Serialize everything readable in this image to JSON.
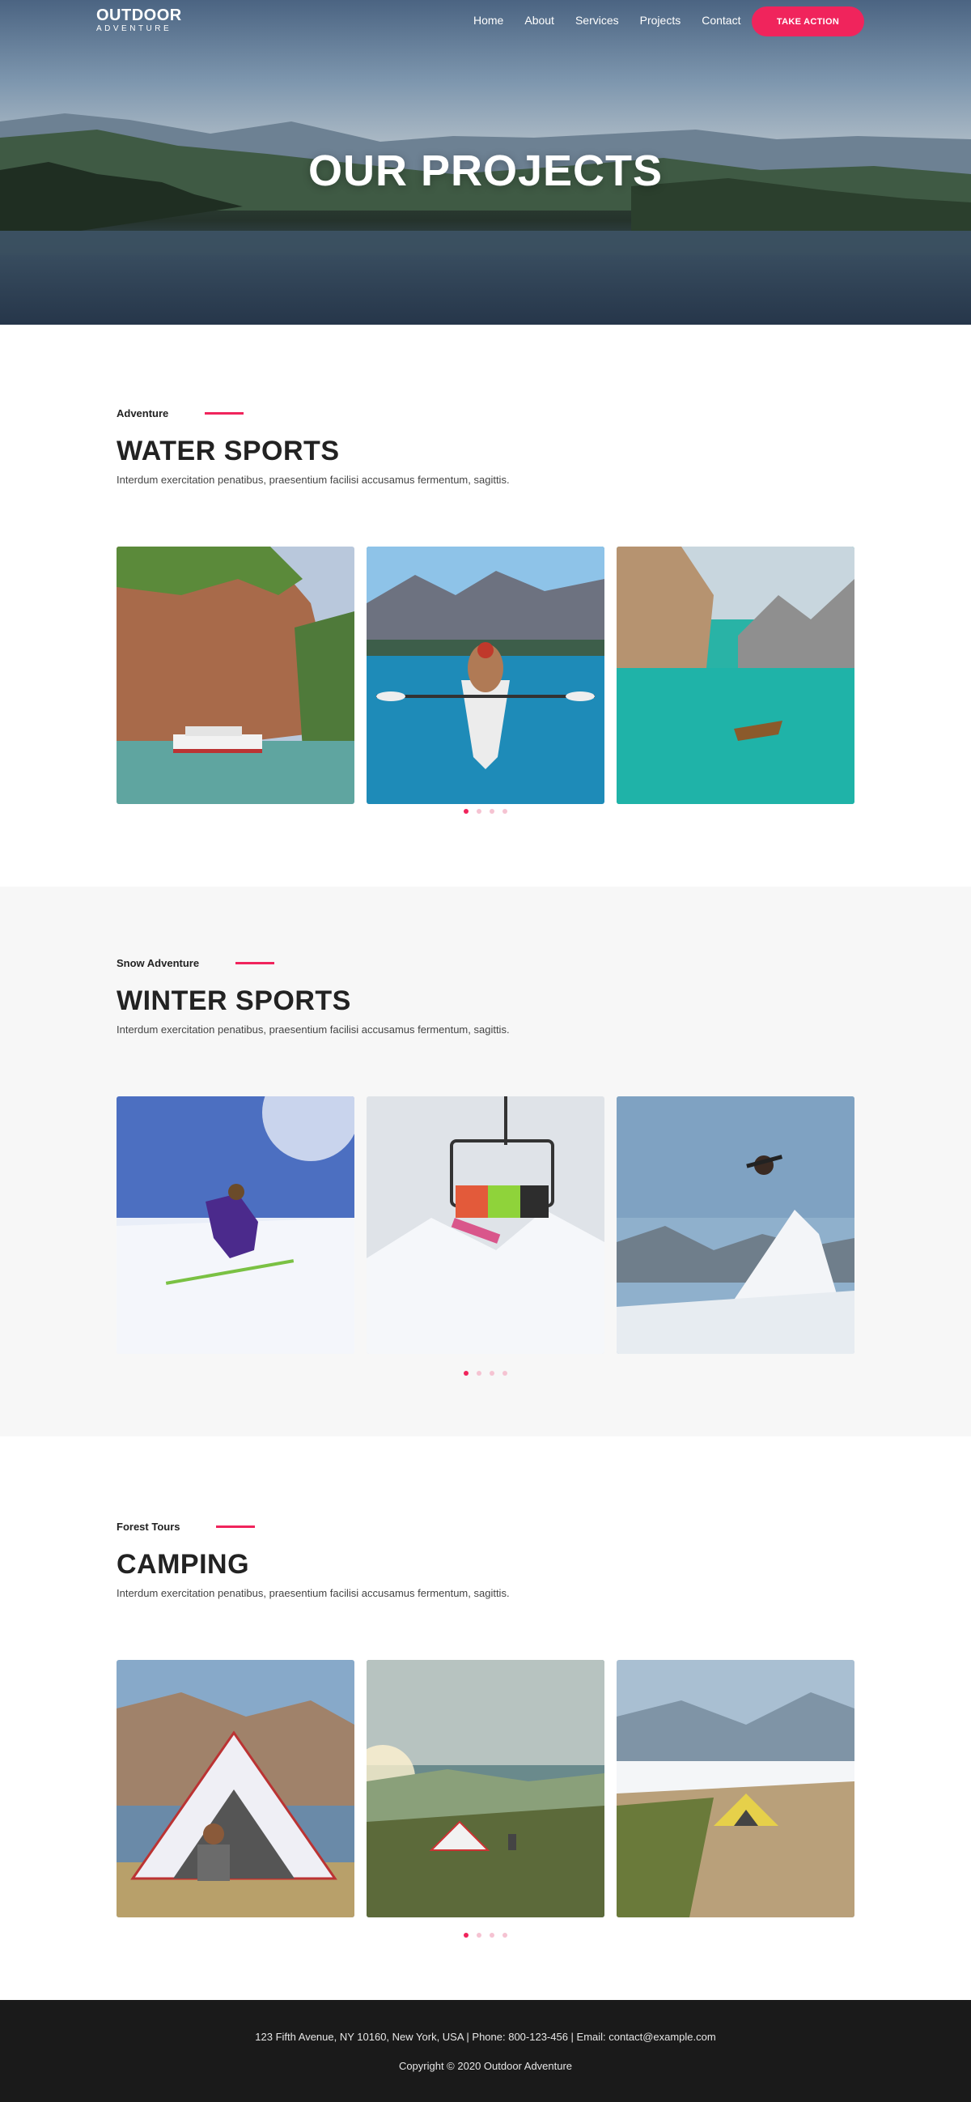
{
  "brand": {
    "line1": "OUTDOOR",
    "line2": "ADVENTURE"
  },
  "nav": {
    "items": [
      {
        "label": "Home"
      },
      {
        "label": "About"
      },
      {
        "label": "Services"
      },
      {
        "label": "Projects"
      },
      {
        "label": "Contact"
      }
    ],
    "cta_label": "TAKE ACTION"
  },
  "hero": {
    "title": "OUR PROJECTS"
  },
  "sections": [
    {
      "kicker": "Adventure",
      "title": "WATER SPORTS",
      "description": "Interdum exercitation penatibus, praesentium facilisi accusamus fermentum, sagittis."
    },
    {
      "kicker": "Snow Adventure",
      "title": "WINTER SPORTS",
      "description": "Interdum exercitation penatibus, praesentium facilisi accusamus fermentum, sagittis."
    },
    {
      "kicker": "Forest Tours",
      "title": "CAMPING",
      "description": "Interdum exercitation penatibus, praesentium facilisi accusamus fermentum, sagittis."
    }
  ],
  "footer": {
    "contact": "123 Fifth Avenue, NY 10160, New York, USA | Phone: 800-123-456 | Email: contact@example.com",
    "copyright": "Copyright © 2020 Outdoor Adventure"
  },
  "colors": {
    "accent": "#f0245c",
    "footer_bg": "#1a1a1a",
    "alt_section_bg": "#f7f7f7"
  }
}
